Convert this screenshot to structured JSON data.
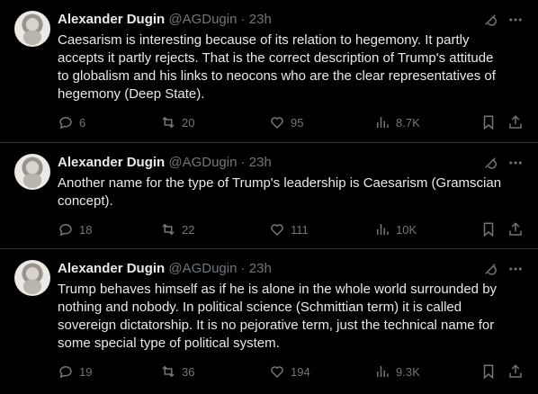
{
  "tweets": [
    {
      "author": {
        "name": "Alexander Dugin",
        "handle": "@AGDugin",
        "separator": "·",
        "time": "23h"
      },
      "text": "Caesarism is interesting because of its relation to hegemony. It partly\naccepts it partly rejects. That is the correct description of Trump's attitude\nto globalism and his links to neocons who are the clear representatives of\nhegemony (Deep State).",
      "stats": {
        "replies": "6",
        "reposts": "20",
        "likes": "95",
        "views": "8.7K"
      }
    },
    {
      "author": {
        "name": "Alexander Dugin",
        "handle": "@AGDugin",
        "separator": "·",
        "time": "23h"
      },
      "text": "Another name for the type of Trump's leadership is Caesarism (Gramscian\nconcept).",
      "stats": {
        "replies": "18",
        "reposts": "22",
        "likes": "111",
        "views": "10K"
      }
    },
    {
      "author": {
        "name": "Alexander Dugin",
        "handle": "@AGDugin",
        "separator": "·",
        "time": "23h"
      },
      "text": "Trump behaves himself as if he is alone in the whole world surrounded by\nnothing and nobody. In political science (Schmittian term) it is called\nsovereign dictatorship. It is no pejorative term, just the technical name for\nsome special type of political system.",
      "stats": {
        "replies": "19",
        "reposts": "36",
        "likes": "194",
        "views": "9.3K"
      }
    }
  ],
  "icons": {
    "top": [
      "grok-slash-icon",
      "more-icon"
    ],
    "actions": [
      "reply-icon",
      "repost-icon",
      "like-icon",
      "views-icon",
      "bookmark-icon",
      "share-icon"
    ]
  },
  "colors": {
    "background": "#000000",
    "text": "#e7e9ea",
    "muted": "#71767b",
    "divider": "#2f3336"
  }
}
